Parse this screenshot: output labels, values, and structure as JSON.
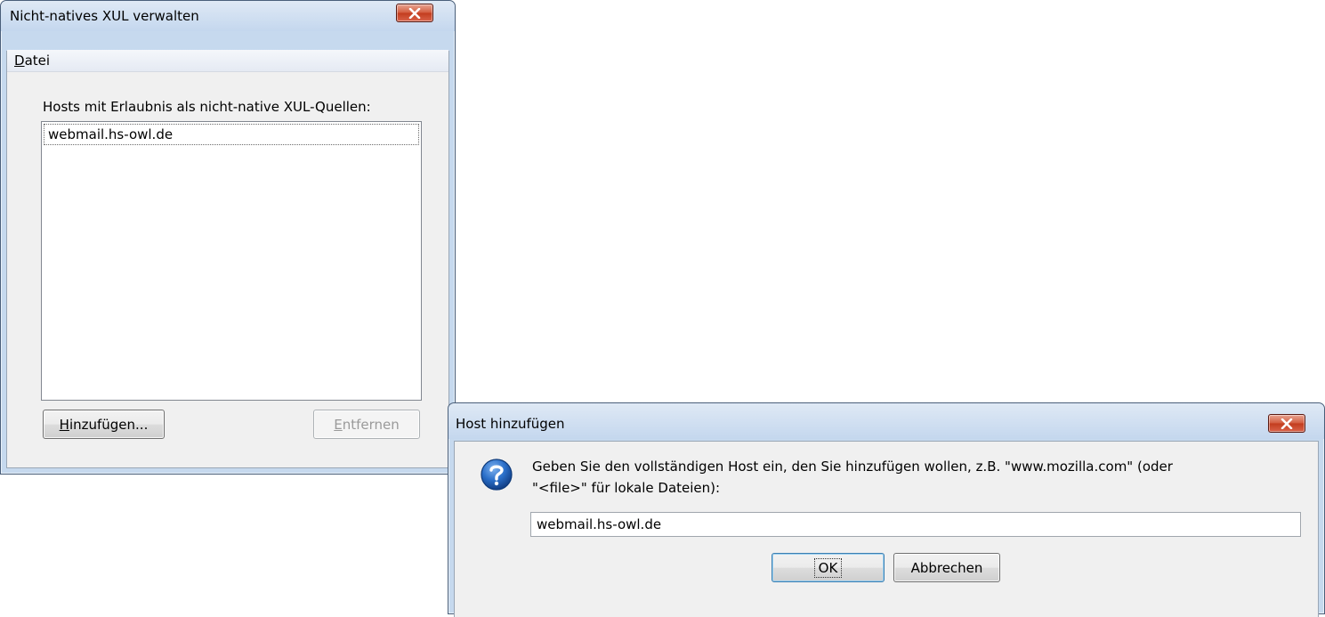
{
  "manage_window": {
    "title": "Nicht-natives XUL verwalten",
    "menu": {
      "file_label": "Datei",
      "file_accesskey": "D",
      "file_rest": "atei"
    },
    "hosts_label": "Hosts mit Erlaubnis als nicht-native XUL-Quellen:",
    "hosts": [
      "webmail.hs-owl.de"
    ],
    "add_button": {
      "accesskey": "H",
      "rest": "inzufügen..."
    },
    "remove_button": {
      "accesskey": "E",
      "rest": "ntfernen",
      "enabled": false
    }
  },
  "add_host_dialog": {
    "title": "Host hinzufügen",
    "icon": "question-icon",
    "prompt_line1": "Geben Sie den vollständigen Host ein, den Sie hinzufügen wollen, z.B. \"www.mozilla.com\" (oder",
    "prompt_line2": "\"<file>\" für lokale Dateien):",
    "host_input_value": "webmail.hs-owl.de",
    "ok_label": "OK",
    "cancel_label": "Abbrechen"
  },
  "colors": {
    "frame": "#c6d9ee",
    "client": "#f0f0f0",
    "close_red": "#c23c1d",
    "question_blue": "#1a5fb4"
  }
}
